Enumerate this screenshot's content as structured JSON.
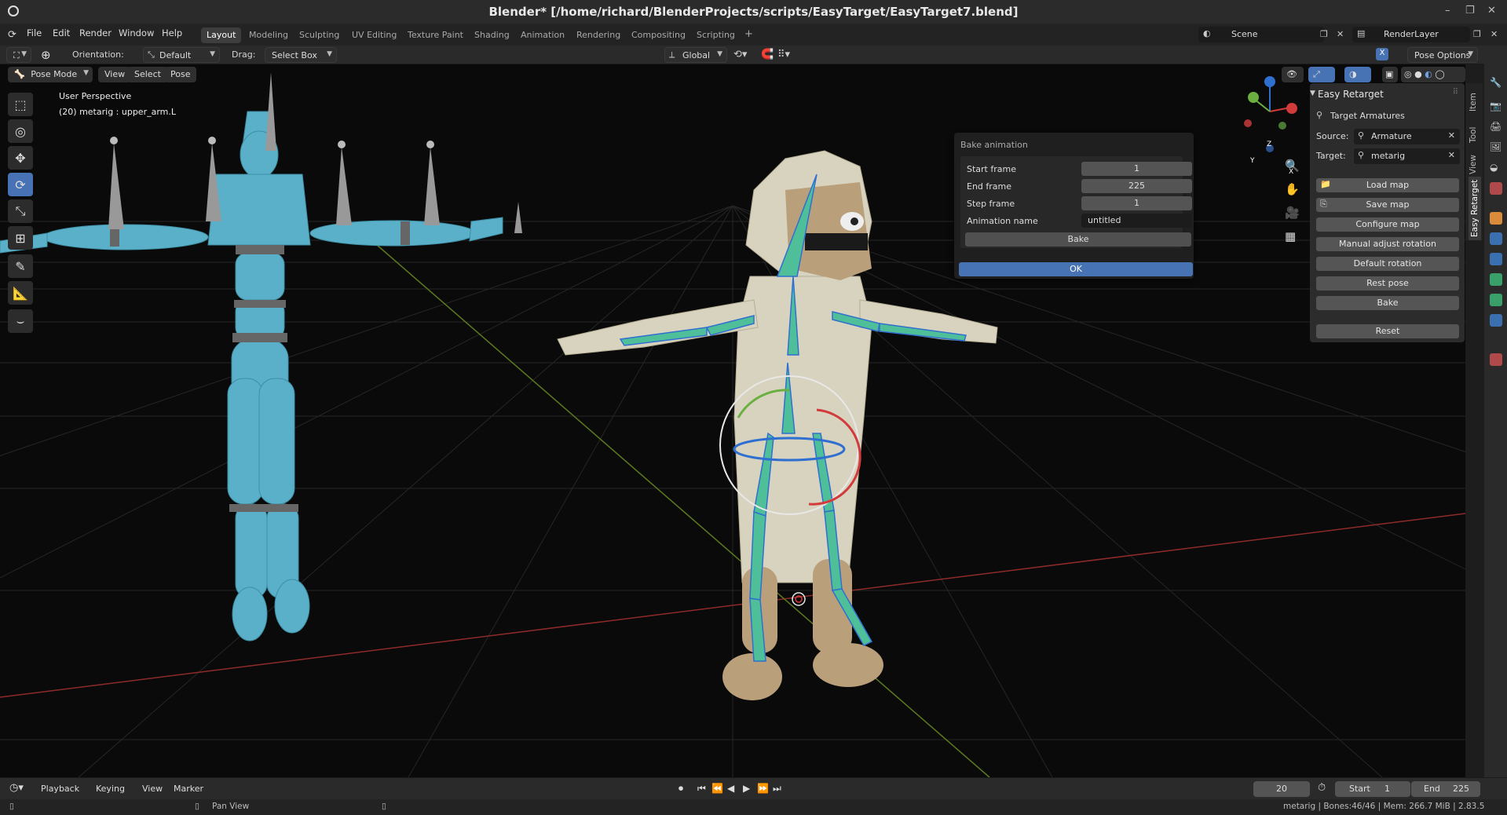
{
  "window": {
    "title": "Blender* [/home/richard/BlenderProjects/scripts/EasyTarget/EasyTarget7.blend]",
    "controls": [
      "–",
      "❐",
      "✕"
    ]
  },
  "menu": [
    "File",
    "Edit",
    "Render",
    "Window",
    "Help"
  ],
  "workspaces": [
    {
      "label": "Layout",
      "active": true
    },
    {
      "label": "Modeling"
    },
    {
      "label": "Sculpting"
    },
    {
      "label": "UV Editing"
    },
    {
      "label": "Texture Paint"
    },
    {
      "label": "Shading"
    },
    {
      "label": "Animation"
    },
    {
      "label": "Rendering"
    },
    {
      "label": "Compositing"
    },
    {
      "label": "Scripting"
    },
    {
      "label": "+"
    }
  ],
  "scene": {
    "name": "Scene",
    "view_layer": "RenderLayer"
  },
  "header": {
    "orientation_label": "Orientation:",
    "orientation_value": "Default",
    "drag_label": "Drag:",
    "drag_value": "Select Box",
    "transform_orientation": "Global",
    "pose_options": "Pose Options"
  },
  "viewport": {
    "mode": "Pose Mode",
    "menus": [
      "View",
      "Select",
      "Pose"
    ],
    "overlay_title": "User Perspective",
    "overlay_object": "(20) metarig : upper_arm.L",
    "axis_labels": {
      "z": "Z",
      "y": "Y",
      "x": "X"
    }
  },
  "bake_popup": {
    "title": "Bake animation",
    "fields": [
      {
        "label": "Start frame",
        "value": "1"
      },
      {
        "label": "End frame",
        "value": "225"
      },
      {
        "label": "Step frame",
        "value": "1"
      },
      {
        "label": "Animation name",
        "value": "untitled"
      }
    ],
    "bake_label": "Bake",
    "ok_label": "OK"
  },
  "npanel": {
    "header": "Easy Retarget",
    "section": "Target Armatures",
    "source_label": "Source:",
    "source_value": "Armature",
    "target_label": "Target:",
    "target_value": "metarig",
    "buttons": [
      "Load map",
      "Save map",
      "Configure map",
      "Manual adjust rotation",
      "Default rotation",
      "Rest pose",
      "Bake",
      "Reset"
    ],
    "tabs": [
      "Item",
      "Tool",
      "View",
      "Easy Retarget"
    ]
  },
  "timeline": {
    "menus": [
      "Playback",
      "Keying",
      "View",
      "Marker"
    ],
    "current_frame": "20",
    "start_label": "Start",
    "start_value": "1",
    "end_label": "End",
    "end_value": "225"
  },
  "statusbar": {
    "hint": "Pan View",
    "info": "metarig | Bones:46/46 | Mem: 266.7 MiB | 2.83.5"
  },
  "colors": {
    "accent": "#4772b3",
    "viewport_bg": "#0a0a0a",
    "mannequin": "#5ab0c8",
    "creature_fur": "#d8d3bf",
    "bone": "#4fbf9a"
  }
}
